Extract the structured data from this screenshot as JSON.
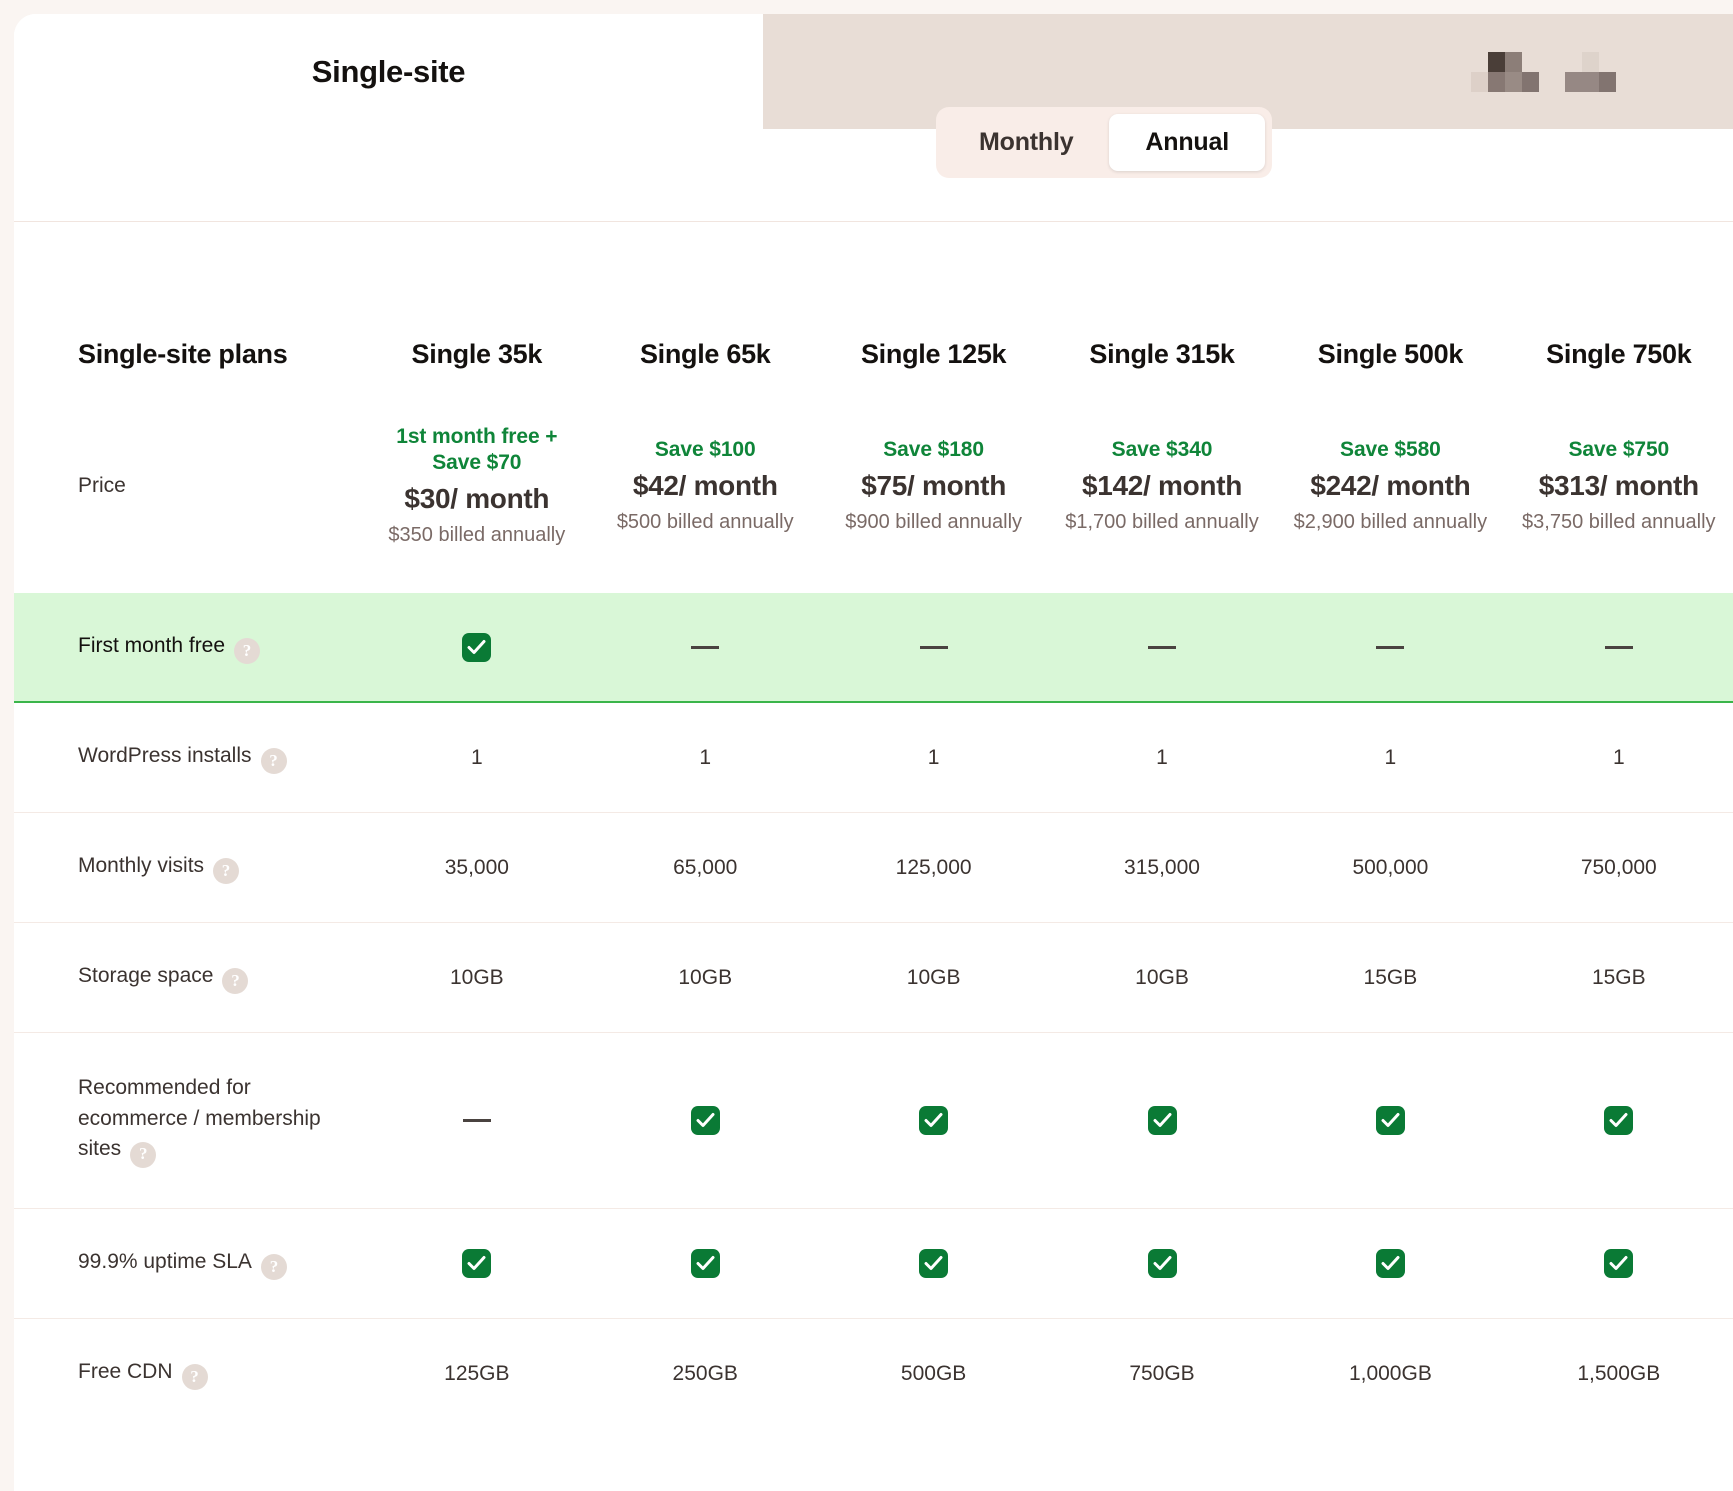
{
  "tabs": [
    {
      "label": "Single-site",
      "active": true
    },
    {
      "label": "",
      "active": false,
      "redacted": true
    }
  ],
  "billing_toggle": {
    "monthly_label": "Monthly",
    "annual_label": "Annual",
    "selected": "Annual"
  },
  "table": {
    "label_header": "Single-site plans",
    "plans": [
      "Single 35k",
      "Single 65k",
      "Single 125k",
      "Single 315k",
      "Single 500k",
      "Single 750k"
    ],
    "price_row": {
      "label": "Price",
      "cells": [
        {
          "save": "1st month free + Save $70",
          "amount": "$30/ month",
          "billed": "$350 billed annually"
        },
        {
          "save": "Save $100",
          "amount": "$42/ month",
          "billed": "$500 billed annually"
        },
        {
          "save": "Save $180",
          "amount": "$75/ month",
          "billed": "$900 billed annually"
        },
        {
          "save": "Save $340",
          "amount": "$142/ month",
          "billed": "$1,700 billed annually"
        },
        {
          "save": "Save $580",
          "amount": "$242/ month",
          "billed": "$2,900 billed annually"
        },
        {
          "save": "Save $750",
          "amount": "$313/ month",
          "billed": "$3,750 billed annually"
        }
      ]
    },
    "features": [
      {
        "label": "First month free",
        "help": "?",
        "highlight": true,
        "values": [
          "check",
          "dash",
          "dash",
          "dash",
          "dash",
          "dash"
        ]
      },
      {
        "label": "WordPress installs",
        "help": "?",
        "highlight": false,
        "values": [
          "1",
          "1",
          "1",
          "1",
          "1",
          "1"
        ]
      },
      {
        "label": "Monthly visits",
        "help": "?",
        "highlight": false,
        "values": [
          "35,000",
          "65,000",
          "125,000",
          "315,000",
          "500,000",
          "750,000"
        ]
      },
      {
        "label": "Storage space",
        "help": "?",
        "highlight": false,
        "values": [
          "10GB",
          "10GB",
          "10GB",
          "10GB",
          "15GB",
          "15GB"
        ]
      },
      {
        "label": "Recommended for ecommerce / membership sites",
        "help": "?",
        "highlight": false,
        "tall": true,
        "values": [
          "dash",
          "check",
          "check",
          "check",
          "check",
          "check"
        ]
      },
      {
        "label": "99.9% uptime SLA",
        "help": "?",
        "highlight": false,
        "values": [
          "check",
          "check",
          "check",
          "check",
          "check",
          "check"
        ]
      },
      {
        "label": "Free CDN",
        "help": "?",
        "highlight": false,
        "values": [
          "125GB",
          "250GB",
          "500GB",
          "750GB",
          "1,000GB",
          "1,500GB"
        ]
      }
    ]
  },
  "colors": {
    "accent_green": "#0f8539",
    "check_green": "#0a7a35",
    "highlight_bg": "#d9f7d7",
    "tab_inactive_bg": "#e8ddd6",
    "toggle_bg": "#f9ede8",
    "page_bg": "#faf5f2"
  }
}
